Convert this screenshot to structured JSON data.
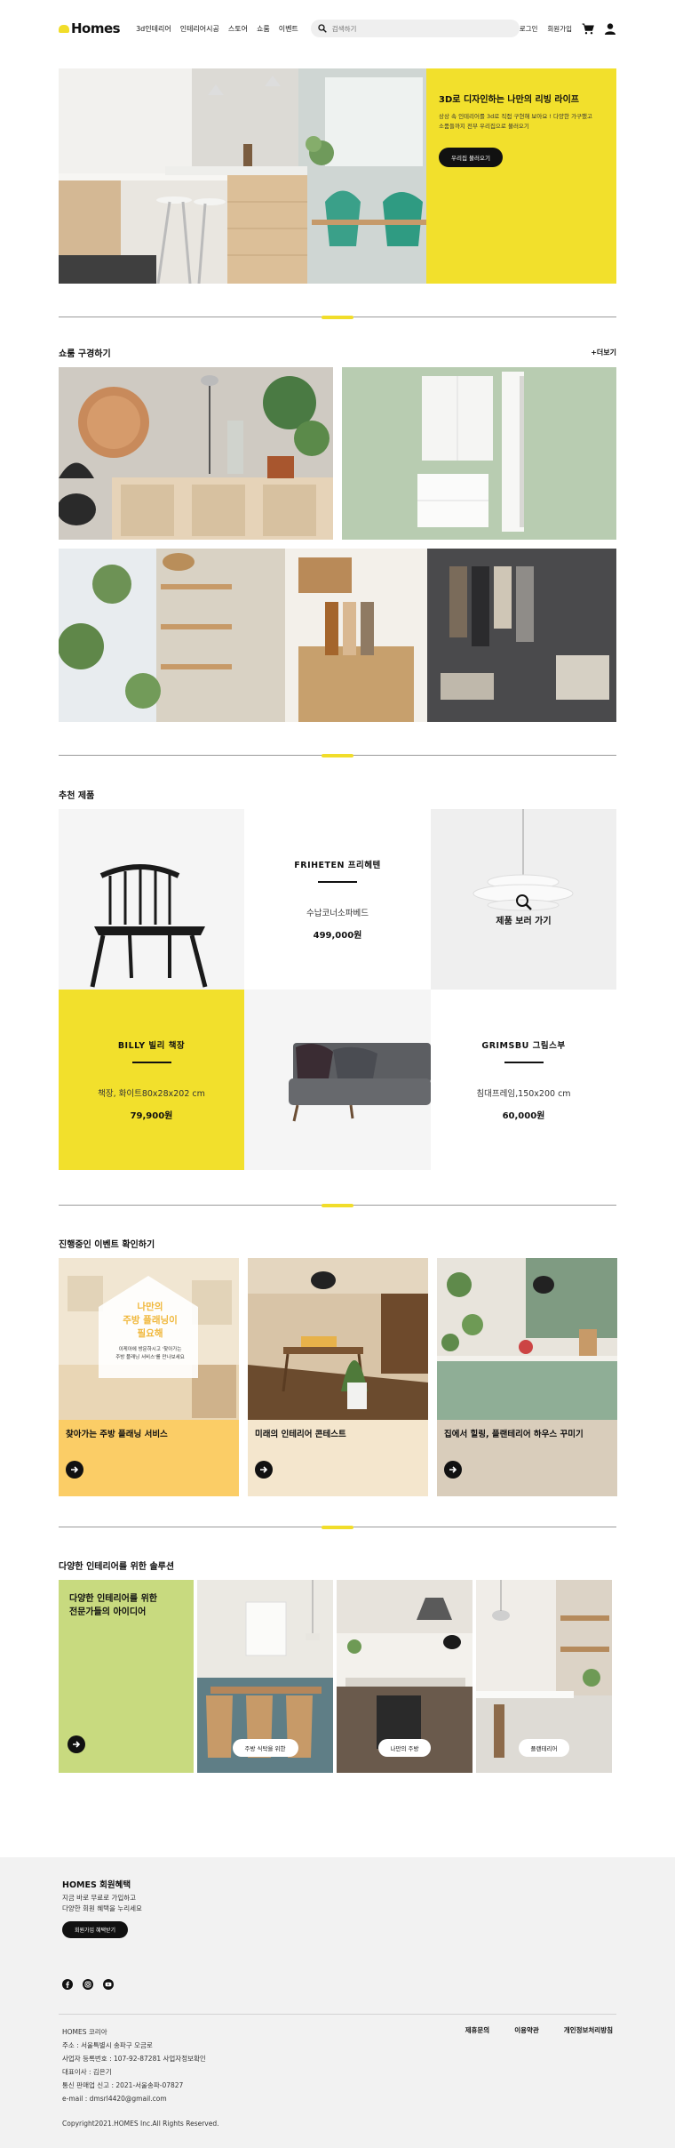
{
  "header": {
    "logo": "Homes",
    "nav": [
      "3d인테리어",
      "인테리어시공",
      "스토어",
      "쇼룸",
      "이벤트"
    ],
    "search_placeholder": "검색하기",
    "login": "로그인",
    "signup": "회원가입"
  },
  "hero": {
    "title": "3D로 디자인하는 나만의 리빙 라이프",
    "desc_line1": "상상 속 인테리어를 3d로 직접 구현해 보아요 ! 다양한 가구했고",
    "desc_line2": "소품들까지 전부 우리집으로 불러오기",
    "button": "우리집 불러오기"
  },
  "shop": {
    "title": "쇼룸 구경하기",
    "more": "+더보기"
  },
  "recommended": {
    "title": "추천 제품",
    "items": [
      {
        "name": "FRIHETEN 프리헤텐",
        "desc": "수납코너소파베드",
        "price": "499,000원"
      },
      {
        "name": "BILLY 빌리 책장",
        "desc": "책장, 화이트80x28x202 cm",
        "price": "79,900원"
      },
      {
        "name": "GRIMSBU 그림스부",
        "desc": "침대프레임,150x200 cm",
        "price": "60,000원"
      }
    ],
    "view_product": "제품 보러 가기"
  },
  "events": {
    "title": "진행중인 이벤트 확인하기",
    "items": [
      {
        "title": "찾아가는 주방 플래닝 서비스",
        "overlay_title": "나만의\n주방 플래닝이\n필요해",
        "overlay_desc": "이케아에 방문하시고 '찾아가는\n주방 플래닝 서비스'를 만나보세요"
      },
      {
        "title": "미래의 인테리어 콘테스트"
      },
      {
        "title": "집에서 힐링, 플랜테리어 하우스 꾸미기"
      }
    ],
    "colors": [
      "#fbcd66",
      "#f4e6cd",
      "#d9cdbb"
    ]
  },
  "solutions": {
    "title": "다양한 인테리어를 위한 솔루션",
    "first_line1": "다양한 인테리어를 위한",
    "first_line2": "전문가들의 아이디어",
    "tags": [
      "주방 식탁을 위한",
      "나만의 주방",
      "플랜테리어"
    ]
  },
  "footer": {
    "title": "HOMES 회원혜택",
    "desc_line1": "지금 바로 무료로 가입하고",
    "desc_line2": "다양한 회원 혜택을 누리세요",
    "button": "회원가입 혜택받기",
    "company": "HOMES 코리아",
    "address": "주소 : 서울특별시 송파구 오금로",
    "biz_no": "사업자 등록번호 : 107-92-87281 사업자정보확인",
    "ceo": "대표이사 : 김은기",
    "telecom": "통신 판매업 신고 : 2021-서울송파-07827",
    "email": "e-mail : dmsrl4420@gmail.com",
    "copyright": "Copyright2021.HOMES Inc.All Rights Reserved.",
    "links": [
      "제휴문의",
      "이용약관",
      "개인정보처리방침"
    ]
  }
}
